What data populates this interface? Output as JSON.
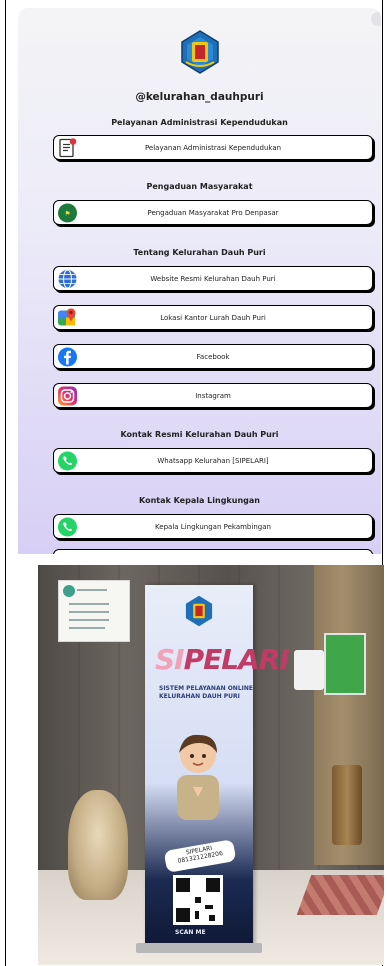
{
  "profile": {
    "handle": "@kelurahan_dauhpuri"
  },
  "sections": [
    {
      "heading": "Pelayanan Administrasi Kependudukan",
      "links": [
        {
          "label": "Pelayanan Administrasi Kependudukan",
          "icon": "document-icon"
        }
      ]
    },
    {
      "heading": "Pengaduan Masyarakat",
      "links": [
        {
          "label": "Pengaduan Masyarakat Pro Denpasar",
          "icon": "complaint-icon"
        }
      ]
    },
    {
      "heading": "Tentang Kelurahan Dauh Puri",
      "links": [
        {
          "label": "Website Resmi Kelurahan Dauh Puri",
          "icon": "globe-icon"
        },
        {
          "label": "Lokasi Kantor Lurah Dauh Puri",
          "icon": "maps-icon"
        },
        {
          "label": "Facebook",
          "icon": "facebook-icon"
        },
        {
          "label": "Instagram",
          "icon": "instagram-icon"
        }
      ]
    },
    {
      "heading": "Kontak Resmi Kelurahan Dauh Puri",
      "links": [
        {
          "label": "Whatsapp Kelurahan [SIPELARI]",
          "icon": "whatsapp-icon"
        }
      ]
    },
    {
      "heading": "Kontak Kepala Lingkungan",
      "links": [
        {
          "label": "Kepala Lingkungan Pekambingan",
          "icon": "whatsapp-icon"
        }
      ]
    }
  ],
  "photo": {
    "banner_title_part1": "SI",
    "banner_title_part2": "PELARI",
    "banner_subtitle_1": "SISTEM PELAYANAN ONLINE",
    "banner_subtitle_2": "KELURAHAN DAUH PURI",
    "banner_contact_name": "SIPELARI",
    "banner_contact_phone": "081321228206",
    "banner_scan": "SCAN ME"
  },
  "colors": {
    "gradient_top": "#f4f4f6",
    "gradient_bottom": "#d7cff5",
    "button_border": "#000000",
    "whatsapp": "#25d366",
    "facebook": "#1877f2"
  }
}
